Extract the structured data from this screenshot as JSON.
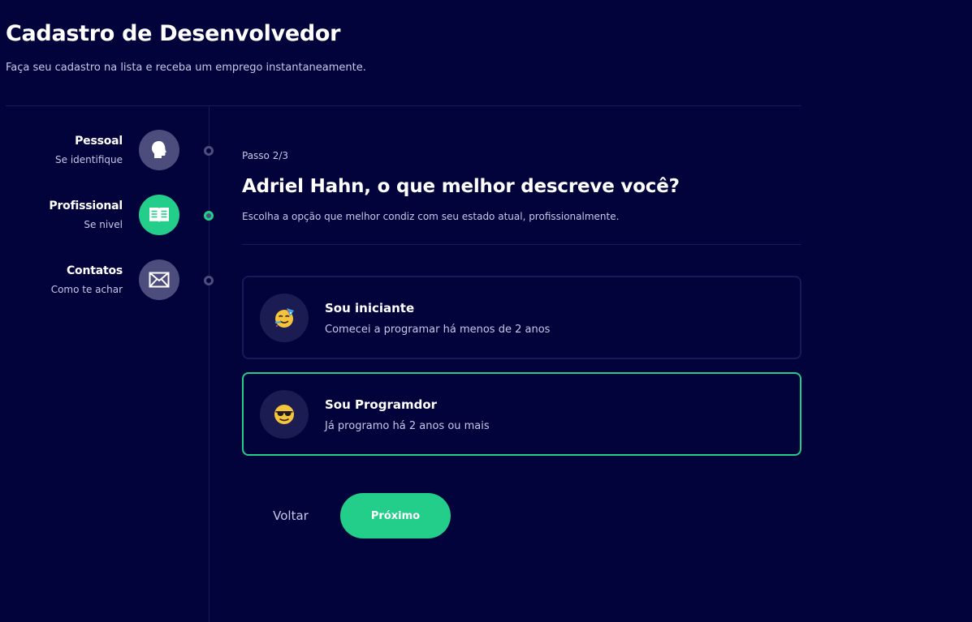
{
  "header": {
    "title": "Cadastro de Desenvolvedor",
    "subtitle": "Faça seu cadastro na lista e receba um emprego instantaneamente."
  },
  "steps": [
    {
      "title": "Pessoal",
      "subtitle": "Se identifique",
      "icon": "head-icon",
      "active": false
    },
    {
      "title": "Profissional",
      "subtitle": "Se nivel",
      "icon": "book-icon",
      "active": true
    },
    {
      "title": "Contatos",
      "subtitle": "Como te achar",
      "icon": "envelope-icon",
      "active": false
    }
  ],
  "main": {
    "step_counter": "Passo 2/3",
    "title": "Adriel Hahn, o que melhor descreve você?",
    "subtitle": "Escolha a opção que melhor condiz com seu estado atual, profissionalmente."
  },
  "options": [
    {
      "title": "Sou iniciante",
      "description": "Comecei a programar há menos de 2 anos",
      "icon": "party-face-emoji",
      "selected": false
    },
    {
      "title": "Sou Programdor",
      "description": "Já programo há 2 anos ou mais",
      "icon": "sunglasses-face-emoji",
      "selected": true
    }
  ],
  "actions": {
    "back_label": "Voltar",
    "next_label": "Próximo"
  },
  "colors": {
    "background": "#02033b",
    "accent": "#23ce8a",
    "inactive_icon_bg": "#4d4d7d",
    "divider": "#16195a",
    "muted_text": "#c7c8e8"
  }
}
